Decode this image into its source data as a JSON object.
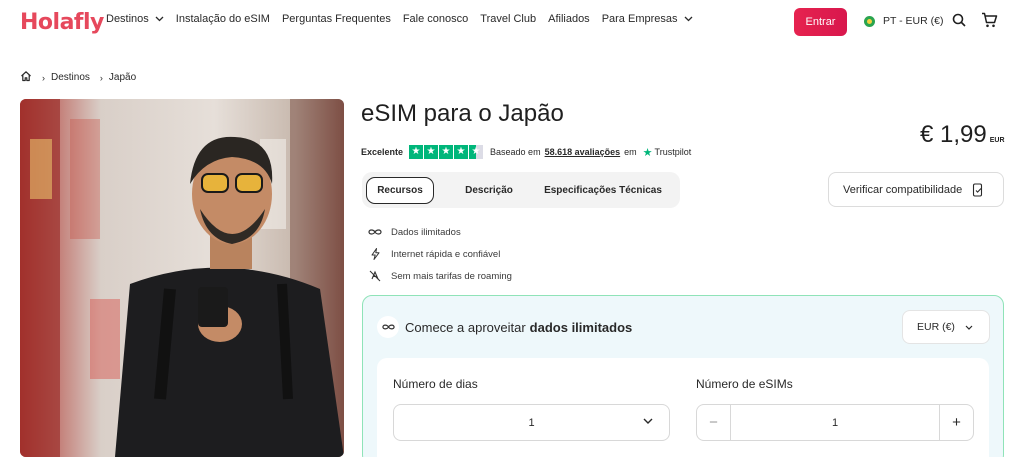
{
  "header": {
    "logo": "Holafly",
    "nav": [
      {
        "label": "Destinos",
        "has_dropdown": true
      },
      {
        "label": "Instalação do eSIM"
      },
      {
        "label": "Perguntas Frequentes"
      },
      {
        "label": "Fale conosco"
      },
      {
        "label": "Travel Club"
      },
      {
        "label": "Afiliados"
      },
      {
        "label": "Para Empresas",
        "has_dropdown": true
      }
    ],
    "login_label": "Entrar",
    "language": "PT - EUR (€)",
    "icons": [
      "search-icon",
      "cart-icon"
    ]
  },
  "breadcrumb": {
    "home_icon": "home-icon",
    "items": [
      "Destinos",
      "Japão"
    ]
  },
  "product": {
    "title": "eSIM para o Japão",
    "rating_text": "Excelente",
    "stars": 4.5,
    "based_on": "Baseado em",
    "reviews": "58.618 avaliações",
    "on": "em",
    "trustpilot": "Trustpilot",
    "price": "€ 1,99",
    "currency": "EUR",
    "tabs": [
      "Recursos",
      "Descrição",
      "Especificações Técnicas"
    ],
    "active_tab": "Recursos",
    "compat_label": "Verificar compatibilidade",
    "features": [
      {
        "icon": "infinity-icon",
        "label": "Dados ilimitados"
      },
      {
        "icon": "lightning-icon",
        "label": "Internet rápida e confiável"
      },
      {
        "icon": "no-roaming-icon",
        "label": "Sem mais tarifas de roaming"
      }
    ]
  },
  "plan": {
    "heading_prefix": "Comece a aproveitar",
    "heading_bold": "dados ilimitados",
    "currency_select": "EUR (€)",
    "days_label": "Número de dias",
    "days_value": "1",
    "esims_label": "Número de eSIMs",
    "esims_value": "1",
    "minus": "−",
    "plus": "+"
  },
  "colors": {
    "brand": "#e6485c",
    "login_bg": "#e11d48",
    "trustpilot_green": "#00b67a",
    "card_border": "#8fe3b8",
    "card_bg": "#eef8fb"
  }
}
